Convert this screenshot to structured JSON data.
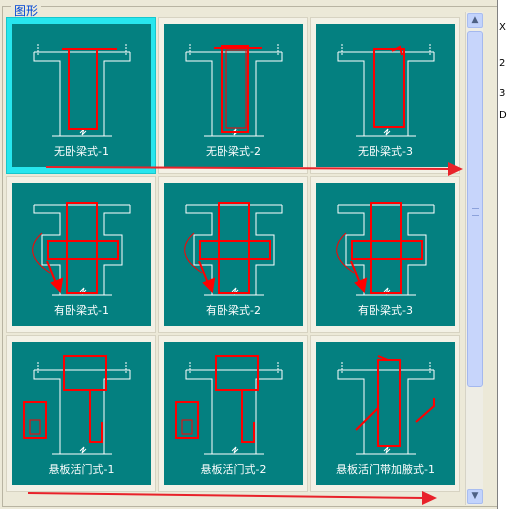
{
  "group_title": "图形",
  "colors": {
    "panel": "#048080",
    "rebar": "#ff0000",
    "outline": "#ffffff",
    "selected_tile": "#27e6ee",
    "annotation": "#e8222a"
  },
  "shapes": [
    {
      "caption": "无卧梁式-1",
      "kind": "T",
      "selected": true
    },
    {
      "caption": "无卧梁式-2",
      "kind": "T2",
      "selected": false
    },
    {
      "caption": "无卧梁式-3",
      "kind": "T3",
      "selected": false
    },
    {
      "caption": "有卧梁式-1",
      "kind": "cross",
      "selected": false
    },
    {
      "caption": "有卧梁式-2",
      "kind": "cross2",
      "selected": false
    },
    {
      "caption": "有卧梁式-3",
      "kind": "cross3",
      "selected": false
    },
    {
      "caption": "悬板活门式-1",
      "kind": "door1",
      "selected": false
    },
    {
      "caption": "悬板活门式-2",
      "kind": "door2",
      "selected": false
    },
    {
      "caption": "悬板活门带加腋式-1",
      "kind": "haunch",
      "selected": false
    }
  ],
  "scrollbar": {
    "up_icon": "scroll-up-arrow",
    "down_icon": "scroll-down-arrow"
  },
  "right_edge_chars": [
    "X",
    "2",
    "3",
    "D"
  ]
}
